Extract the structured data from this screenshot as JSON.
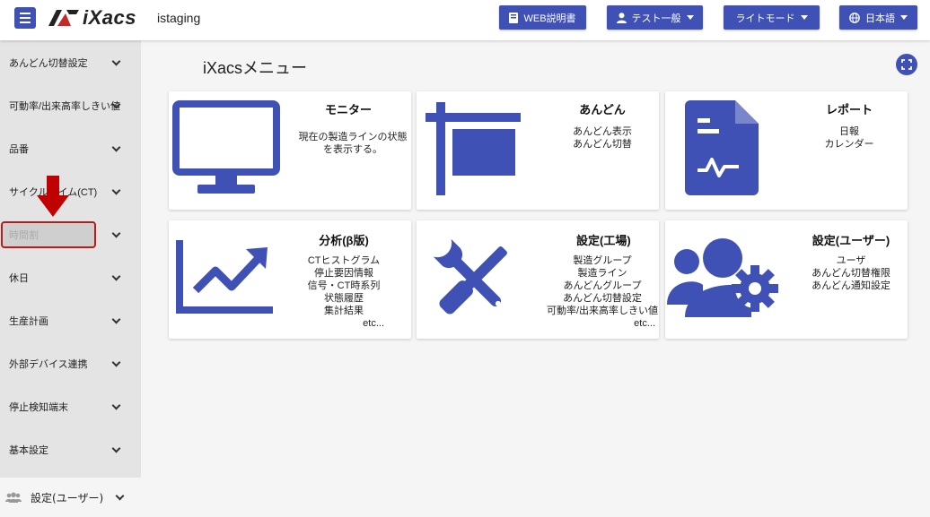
{
  "header": {
    "logo_text": "iXacs",
    "env_name": "istaging",
    "buttons": {
      "manual": "WEB説明書",
      "user": "テスト一般",
      "theme": "ライトモード",
      "language": "日本語"
    }
  },
  "sidebar": {
    "items": [
      {
        "label": "あんどん切替設定"
      },
      {
        "label": "可動率/出来高率しきい値"
      },
      {
        "label": "品番"
      },
      {
        "label": "サイクルタイム(CT)"
      },
      {
        "label": "時間割"
      },
      {
        "label": "休日"
      },
      {
        "label": "生産計画"
      },
      {
        "label": "外部デバイス連携"
      },
      {
        "label": "停止検知端末"
      },
      {
        "label": "基本設定"
      }
    ],
    "bottom_label": "設定(ユーザー)"
  },
  "main": {
    "title": "iXacsメニュー",
    "cards": [
      {
        "title": "モニター",
        "lines": [
          "現在の製造ラインの状態",
          "を表示する。"
        ]
      },
      {
        "title": "あんどん",
        "lines": [
          "あんどん表示",
          "あんどん切替"
        ]
      },
      {
        "title": "レポート",
        "lines": [
          "日報",
          "カレンダー"
        ]
      },
      {
        "title": "分析(β版)",
        "lines": [
          "CTヒストグラム",
          "停止要因情報",
          "信号・CT時系列",
          "状態履歴",
          "集計結果",
          "etc..."
        ]
      },
      {
        "title": "設定(工場)",
        "lines": [
          "製造グループ",
          "製造ライン",
          "あんどんグループ",
          "あんどん切替設定",
          "可動率/出来高率しきい値",
          "etc..."
        ]
      },
      {
        "title": "設定(ユーザー)",
        "lines": [
          "ユーザ",
          "あんどん切替権限",
          "あんどん通知設定"
        ]
      }
    ]
  },
  "colors": {
    "accent": "#3f51b5",
    "highlight_border": "#b71c1c",
    "arrow": "#c00000"
  }
}
